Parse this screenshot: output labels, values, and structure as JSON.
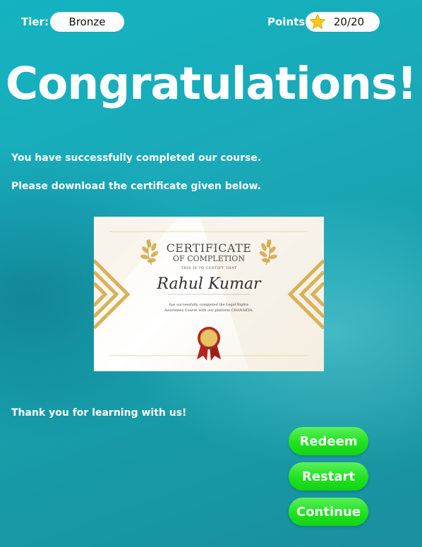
{
  "header": {
    "tier_label": "Tier:",
    "tier_value": "Bronze",
    "points_label": "Points:",
    "points_value": "20/20",
    "points_icon": "star-icon"
  },
  "main": {
    "title": "Congratulations!",
    "message_completed": "You have successfully completed our course.",
    "message_download": "Please download the certificate given below.",
    "message_thanks": "Thank you for learning with us!"
  },
  "certificate": {
    "title": "CERTIFICATE",
    "subtitle": "OF COMPLETION",
    "certify_text": "THIS IS TO CERTIFY THAT",
    "recipient_name": "Rahul Kumar",
    "body_text": "has successfully completed the Legal Rights Awareness Course with our platform CHANAKYA."
  },
  "actions": {
    "redeem_label": "Redeem",
    "restart_label": "Restart",
    "continue_label": "Continue"
  },
  "colors": {
    "background": "#17a6b5",
    "button_green": "#1ee21f",
    "gold": "#d9b15a"
  }
}
